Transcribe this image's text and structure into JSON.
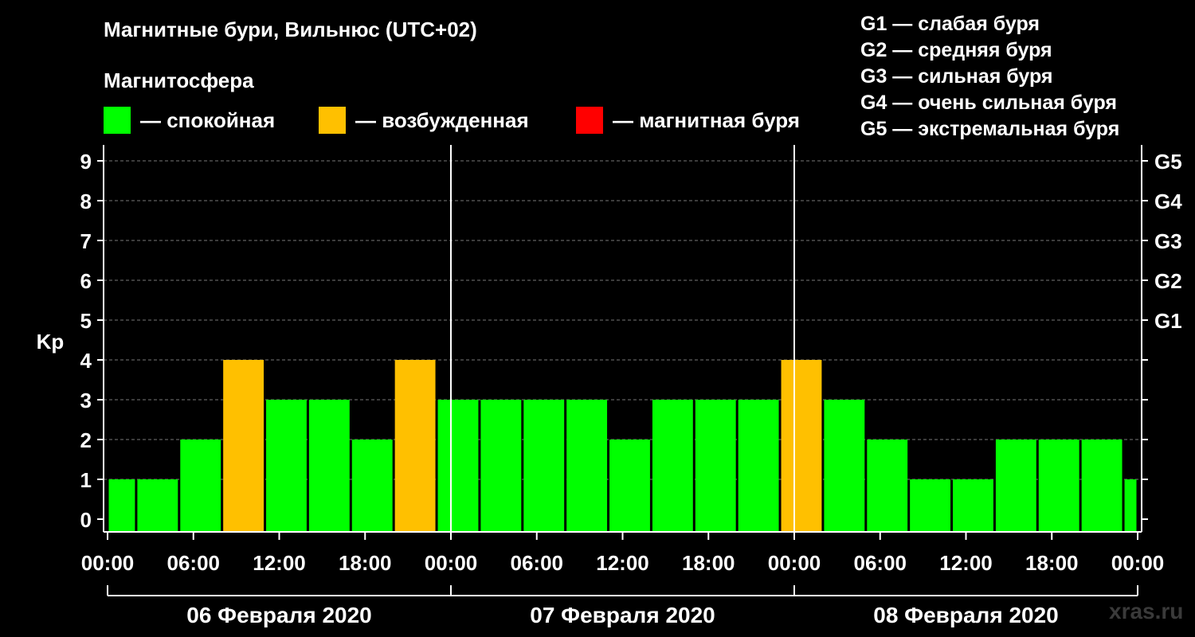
{
  "header": {
    "title": "Магнитные бури, Вильнюс (UTC+02)",
    "subtitle": "Магнитосфера"
  },
  "legend": [
    {
      "label": "— спокойная",
      "color": "#00ff00"
    },
    {
      "label": "— возбужденная",
      "color": "#ffc000"
    },
    {
      "label": "— магнитная буря",
      "color": "#ff0000"
    }
  ],
  "storm_levels": [
    "G1 — слабая буря",
    "G2 — средняя буря",
    "G3 — сильная буря",
    "G4 — очень сильная буря",
    "G5 — экстремальная буря"
  ],
  "watermark": "xras.ru",
  "chart_data": {
    "type": "bar",
    "title": "Магнитные бури, Вильнюс (UTC+02)",
    "ylabel": "Kp",
    "ylim": [
      0,
      9
    ],
    "yticks": [
      0,
      1,
      2,
      3,
      4,
      5,
      6,
      7,
      8,
      9
    ],
    "right_ticks": [
      {
        "value": 5,
        "label": "G1"
      },
      {
        "value": 6,
        "label": "G2"
      },
      {
        "value": 7,
        "label": "G3"
      },
      {
        "value": 8,
        "label": "G4"
      },
      {
        "value": 9,
        "label": "G5"
      }
    ],
    "xlim_hours": [
      0,
      72
    ],
    "xticks": [
      {
        "hour": 0,
        "label": "00:00"
      },
      {
        "hour": 6,
        "label": "06:00"
      },
      {
        "hour": 12,
        "label": "12:00"
      },
      {
        "hour": 18,
        "label": "18:00"
      },
      {
        "hour": 24,
        "label": "00:00"
      },
      {
        "hour": 30,
        "label": "06:00"
      },
      {
        "hour": 36,
        "label": "12:00"
      },
      {
        "hour": 42,
        "label": "18:00"
      },
      {
        "hour": 48,
        "label": "00:00"
      },
      {
        "hour": 54,
        "label": "06:00"
      },
      {
        "hour": 60,
        "label": "12:00"
      },
      {
        "hour": 66,
        "label": "18:00"
      },
      {
        "hour": 72,
        "label": "00:00"
      }
    ],
    "days": [
      "06 Февраля 2020",
      "07 Февраля 2020",
      "08 Февраля 2020"
    ],
    "grid": true,
    "thresholds": {
      "quiet_max": 3,
      "active_max": 4
    },
    "bars": [
      {
        "start": 0,
        "end": 2,
        "kp": 1
      },
      {
        "start": 2,
        "end": 5,
        "kp": 1
      },
      {
        "start": 5,
        "end": 8,
        "kp": 2
      },
      {
        "start": 8,
        "end": 11,
        "kp": 4
      },
      {
        "start": 11,
        "end": 14,
        "kp": 3
      },
      {
        "start": 14,
        "end": 17,
        "kp": 3
      },
      {
        "start": 17,
        "end": 20,
        "kp": 2
      },
      {
        "start": 20,
        "end": 23,
        "kp": 4
      },
      {
        "start": 23,
        "end": 26,
        "kp": 3
      },
      {
        "start": 26,
        "end": 29,
        "kp": 3
      },
      {
        "start": 29,
        "end": 32,
        "kp": 3
      },
      {
        "start": 32,
        "end": 35,
        "kp": 3
      },
      {
        "start": 35,
        "end": 38,
        "kp": 2
      },
      {
        "start": 38,
        "end": 41,
        "kp": 3
      },
      {
        "start": 41,
        "end": 44,
        "kp": 3
      },
      {
        "start": 44,
        "end": 47,
        "kp": 3
      },
      {
        "start": 47,
        "end": 50,
        "kp": 4
      },
      {
        "start": 50,
        "end": 53,
        "kp": 3
      },
      {
        "start": 53,
        "end": 56,
        "kp": 2
      },
      {
        "start": 56,
        "end": 59,
        "kp": 1
      },
      {
        "start": 59,
        "end": 62,
        "kp": 1
      },
      {
        "start": 62,
        "end": 65,
        "kp": 2
      },
      {
        "start": 65,
        "end": 68,
        "kp": 2
      },
      {
        "start": 68,
        "end": 71,
        "kp": 2
      },
      {
        "start": 71,
        "end": 72,
        "kp": 1
      }
    ]
  }
}
